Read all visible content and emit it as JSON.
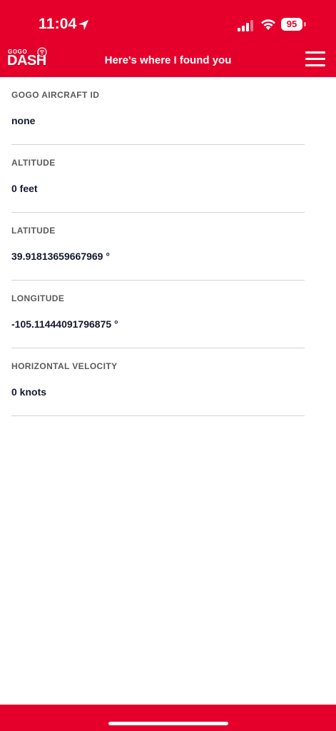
{
  "status_bar": {
    "time": "11:04",
    "battery": "95"
  },
  "header": {
    "logo_small": "GOGO",
    "logo_main": "DASH",
    "title": "Here's where I found you"
  },
  "fields": [
    {
      "label": "GOGO AIRCRAFT ID",
      "value": "none"
    },
    {
      "label": "ALTITUDE",
      "value": "0 feet"
    },
    {
      "label": "LATITUDE",
      "value": "39.91813659667969 °"
    },
    {
      "label": "LONGITUDE",
      "value": "-105.11444091796875 °"
    },
    {
      "label": "HORIZONTAL VELOCITY",
      "value": "0 knots"
    }
  ],
  "colors": {
    "brand_red": "#E4002B",
    "label_gray": "#5a5a5a",
    "value_dark": "#141a2e",
    "divider": "#d3d3d3"
  },
  "icons": {
    "location": "location-arrow-icon",
    "cellular": "cellular-signal-icon",
    "wifi": "wifi-icon",
    "battery": "battery-icon",
    "menu": "hamburger-menu-icon",
    "logo_signal": "signal-broadcast-icon"
  }
}
